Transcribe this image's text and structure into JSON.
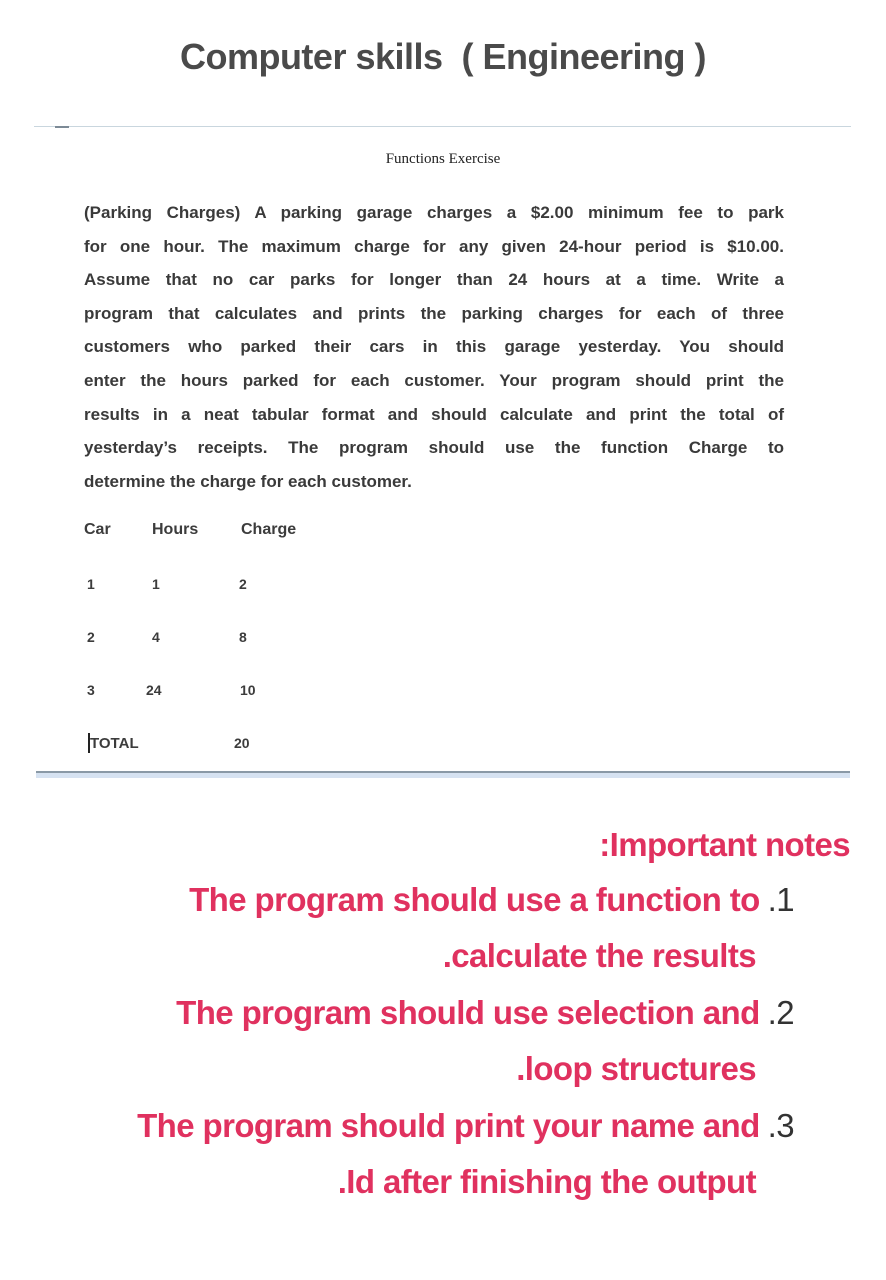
{
  "header": {
    "title": "Computer skills  ( Engineering )"
  },
  "document": {
    "heading": "Functions Exercise",
    "paragraph_lines": [
      "(Parking Charges) A parking garage charges a $2.00 minimum fee to park",
      "for one hour. The maximum charge for any given 24-hour period is $10.00.",
      "Assume that no car parks for longer than 24 hours at a time. Write a",
      "program that calculates and prints the parking charges for each of three",
      "customers who parked their cars in this garage yesterday. You should",
      "enter the hours parked for each customer. Your program should print the",
      "results in a neat tabular format and should calculate and print the total of",
      "yesterday’s receipts. The program should use the function Charge to",
      "determine the charge for each customer."
    ],
    "table": {
      "headers": [
        "Car",
        "Hours",
        "Charge"
      ],
      "rows": [
        {
          "car": "1",
          "hours": "1",
          "charge": "2"
        },
        {
          "car": "2",
          "hours": "4",
          "charge": "8"
        },
        {
          "car": "3",
          "hours": "24",
          "charge": "10"
        }
      ],
      "total_label": "TOTAL",
      "total_value": "20"
    }
  },
  "notes": {
    "heading": ":Important notes",
    "items": [
      {
        "line1": "The program should use a function to",
        "number": ".1",
        "line2": ".calculate the results"
      },
      {
        "line1": "The program should use selection and",
        "number": ".2",
        "line2": ".loop structures"
      },
      {
        "line1": "The program should print your name and",
        "number": ".3",
        "line2": ".Id after finishing the output"
      }
    ]
  },
  "colors": {
    "title": "#4a4a4a",
    "body_text": "#3a3a3a",
    "notes_accent": "#e0315f",
    "note_number": "#333333"
  }
}
